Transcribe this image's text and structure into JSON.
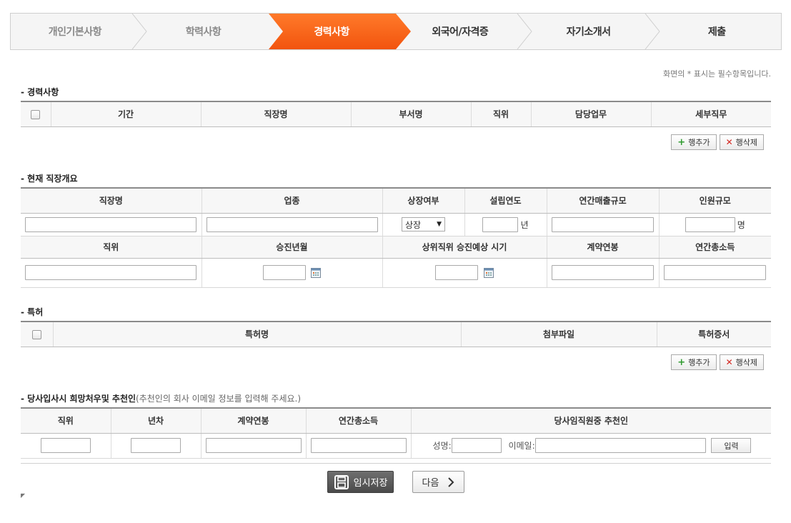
{
  "steps": [
    {
      "label": "개인기본사항",
      "state": "done"
    },
    {
      "label": "학력사항",
      "state": "done"
    },
    {
      "label": "경력사항",
      "state": "active"
    },
    {
      "label": "외국어/자격증",
      "state": "future"
    },
    {
      "label": "자기소개서",
      "state": "future"
    },
    {
      "label": "제출",
      "state": "future"
    }
  ],
  "required_note": "화면의 * 표시는 필수항목입니다.",
  "career": {
    "title": "- 경력사항",
    "columns": [
      "기간",
      "직장명",
      "부서명",
      "직위",
      "담당업무",
      "세부직무"
    ]
  },
  "row_buttons": {
    "add": "행추가",
    "delete": "행삭제"
  },
  "current_job": {
    "title": "- 현재 직장개요",
    "columns1": [
      "직장명",
      "업종",
      "상장여부",
      "설립연도",
      "연간매출규모",
      "인원규모"
    ],
    "listed_value": "상장",
    "year_unit": "년",
    "people_unit": "명",
    "columns2": [
      "직위",
      "승진년월",
      "상위직위 승진예상 시기",
      "계약연봉",
      "연간총소득"
    ]
  },
  "patent": {
    "title": "- 특허",
    "columns": [
      "특허명",
      "첨부파일",
      "특허증서"
    ]
  },
  "hope": {
    "title": "- 당사입사시 희망처우및 추천인",
    "title_sub": "(추천인의 회사 이메일 정보를 입력해 주세요.)",
    "columns": [
      "직위",
      "년차",
      "계약연봉",
      "연간총소득",
      "당사임직원중 추천인"
    ],
    "name_label": "성명:",
    "email_label": "이메일:",
    "input_button": "입력"
  },
  "footer": {
    "save_label": "임시저장",
    "next_label": "다음",
    "corner_mark": "◤"
  },
  "colors": {
    "active_step": "#f2540e",
    "plus": "#2e9a2e",
    "delete_x": "#d2261f"
  }
}
